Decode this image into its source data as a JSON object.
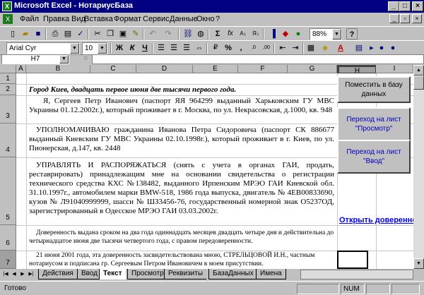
{
  "window": {
    "title": "Microsoft Excel - НотариусБаза",
    "app_icon": "X"
  },
  "menu": [
    "Файл",
    "Правка",
    "Вид",
    "Вставка",
    "Формат",
    "Сервис",
    "Данные",
    "Окно",
    "?"
  ],
  "toolbar": {
    "zoom": "88%",
    "font": "Arial Cyr",
    "font_size": "10",
    "sigma": "Σ",
    "fx": "fx",
    "bold": "Ж",
    "italic": "К",
    "underline": "Ч",
    "percent": "%",
    "comma": ",",
    "help": "?"
  },
  "formula_bar": {
    "name_box": "H7",
    "equals": "="
  },
  "columns": [
    "A",
    "B",
    "C",
    "D",
    "E",
    "F",
    "G",
    "H",
    "I"
  ],
  "rows": [
    "1",
    "2",
    "3",
    "4",
    "5",
    "6",
    "7"
  ],
  "cells": {
    "b2": "Город Киев, двадцать первое июня две тысячи первого года.",
    "b3": "Я, Сергеев Петр Иванович (паспорт ЯЯ 964299 выданный Харьковским ГУ МВС Украины 01.12.2002г.), который проживает в г. Москва, по ул. Некрасовская, д.1000, кв. 948",
    "b4": "УПОЛНОМАЧИВАЮ гражданина Иванова Петра Сидоровича (паспорт СК 886677 выданный Киевским ГУ МВС Украины 02.10.1998г.), который проживает в г. Киев, по ул. Пионерская, д.147, кв. 2448",
    "b5": "УПРАВЛЯТЬ И РАСПОРЯЖАТЬСЯ (снять с учета в органах ГАИ, продать, реставрировать) принадлежащим мне на основании свидетельства о регистрации технического средства КХС №138482, выданного Ирпенским МРЭО ГАИ Киевской обл. 31.10.1997г., автомобилем марки BMW-518, 1986 года выпуска, двигатель № 4EB00833690, кузов № Л91040999999, шасси № ШЗ3456-76, государственный номерной знак О5237ОД, зарегистрированный в Одесское МРЭО ГАИ 03.03.2002г.",
    "b6": "Доверенность выдана сроком на два года одиннадцать месяцев двадцать четыре дня и действительна до четырнадцатое июня две тысячи четвертого года, с правом передоверенности.",
    "b7": "21 июня 2001 года, эта доверенность засвидетельствована мною, СТРЕЛЬЦОВОЙ И.Н., частным нотариусом и подписана гр. Сергеевым Петром Ивановичем в моем присутствии.",
    "h5_link": "Открыть доверенность"
  },
  "buttons": {
    "save_to_db": "Поместить в базу данных",
    "goto_view": "Переход на лист \"Просмотр\"",
    "goto_input": "Переход на лист \"Ввод\""
  },
  "sheet_tabs": [
    "Действия",
    "Ввод",
    "Текст",
    "Просмотр",
    "Реквизиты",
    "БазаДанных",
    "Имена"
  ],
  "active_tab": "Текст",
  "status": {
    "ready": "Готово",
    "num": "NUM"
  }
}
